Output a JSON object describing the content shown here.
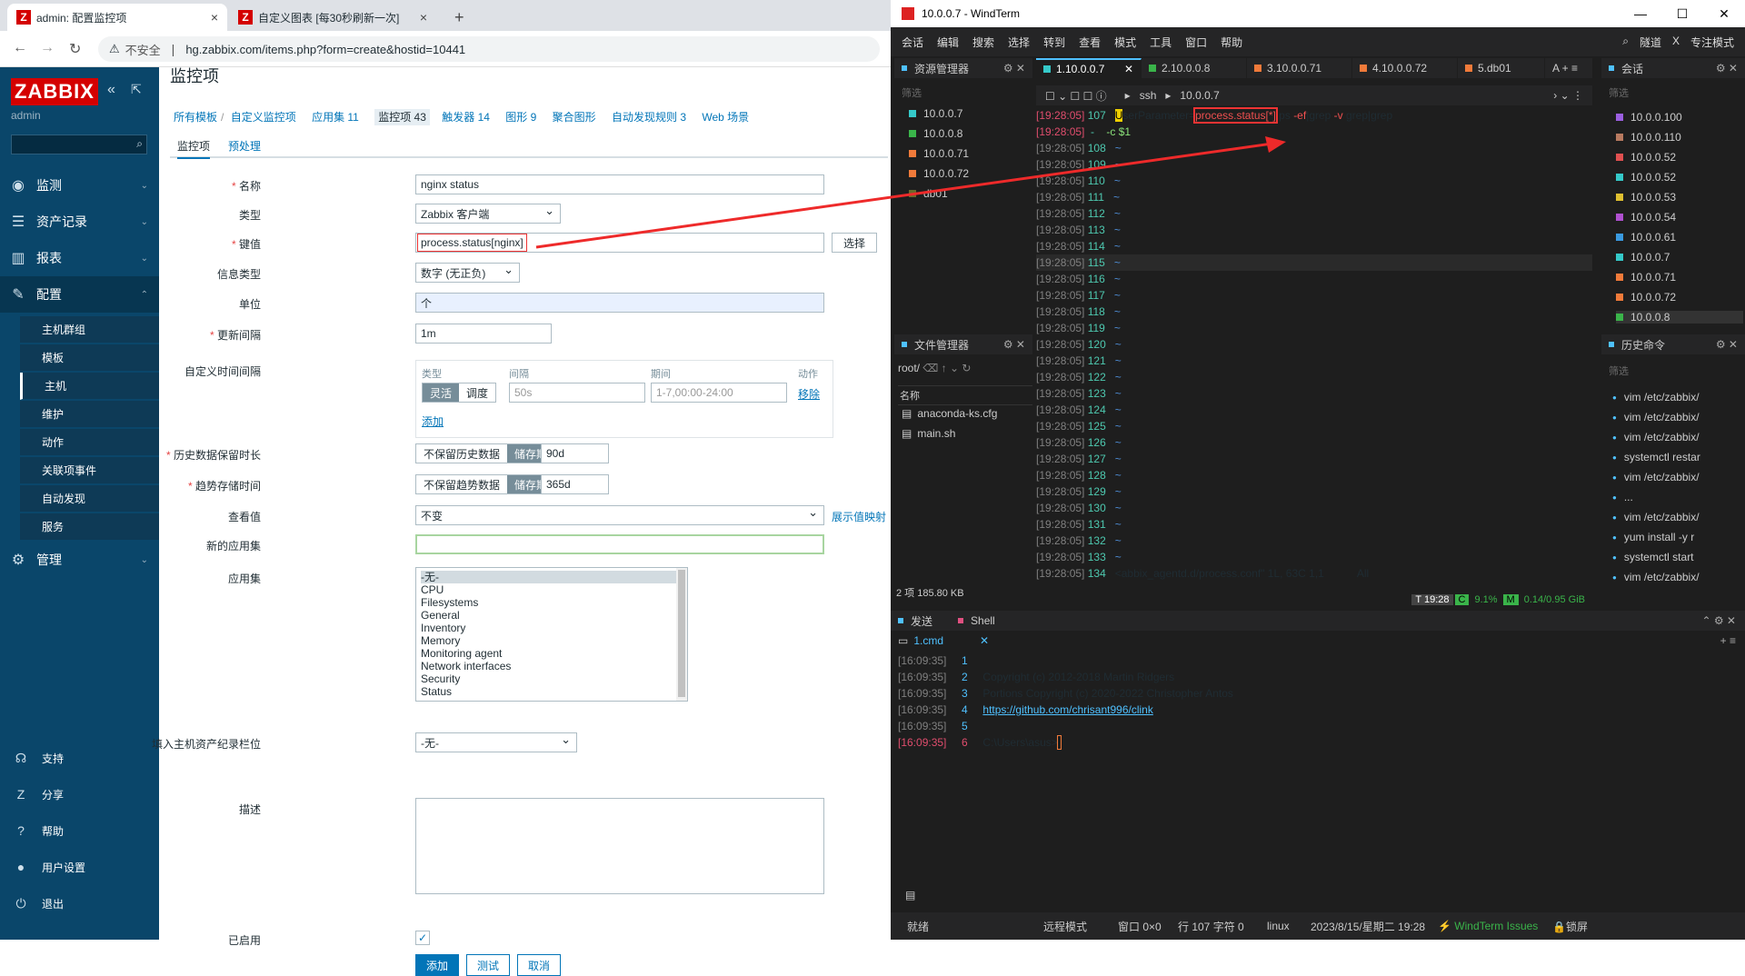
{
  "browser": {
    "tabs": [
      {
        "title": "admin: 配置监控项",
        "close": "×"
      },
      {
        "title": "自定义图表 [每30秒刷新一次]",
        "close": "×"
      }
    ],
    "new_tab": "+",
    "security": "不安全",
    "url": "hg.zabbix.com/items.php?form=create&hostid=10441"
  },
  "zabbix": {
    "logo": "ZABBIX",
    "user": "admin",
    "menu": [
      {
        "label": "监测",
        "icon": "eye-icon"
      },
      {
        "label": "资产记录",
        "icon": "list-icon"
      },
      {
        "label": "报表",
        "icon": "chart-icon"
      },
      {
        "label": "配置",
        "icon": "wrench-icon"
      },
      {
        "label": "管理",
        "icon": "gear-icon"
      }
    ],
    "config_sub": [
      "主机群组",
      "模板",
      "主机",
      "维护",
      "动作",
      "关联项事件",
      "自动发现",
      "服务"
    ],
    "bottom": [
      "支持",
      "分享",
      "帮助",
      "用户设置",
      "退出"
    ],
    "page_title": "监控项",
    "breadcrumb": [
      "所有模板",
      "自定义监控项",
      "应用集 11",
      "监控项 43",
      "触发器 14",
      "图形 9",
      "聚合图形",
      "自动发现规则 3",
      "Web 场景"
    ],
    "tabs": [
      "监控项",
      "预处理"
    ],
    "form": {
      "name_label": "名称",
      "name_value": "nginx status",
      "type_label": "类型",
      "type_value": "Zabbix 客户端",
      "key_label": "键值",
      "key_value": "process.status[nginx]",
      "select_btn": "选择",
      "info_label": "信息类型",
      "info_value": "数字 (无正负)",
      "unit_label": "单位",
      "unit_value": "个",
      "interval_label": "更新间隔",
      "interval_value": "1m",
      "custom_label": "自定义时间间隔",
      "ci_head_type": "类型",
      "ci_head_interval": "间隔",
      "ci_head_period": "期间",
      "ci_head_action": "动作",
      "ci_flexible": "灵活",
      "ci_scheduling": "调度",
      "ci_interval_ph": "50s",
      "ci_period_ph": "1-7,00:00-24:00",
      "ci_remove": "移除",
      "ci_add": "添加",
      "history_label": "历史数据保留时长",
      "history_off": "不保留历史数据",
      "history_on": "储存期",
      "history_value": "90d",
      "trend_label": "趋势存储时间",
      "trend_off": "不保留趋势数据",
      "trend_on": "储存期",
      "trend_value": "365d",
      "valuemap_label": "查看值",
      "valuemap_value": "不变",
      "valuemap_link": "展示值映射",
      "newapp_label": "新的应用集",
      "apps_label": "应用集",
      "apps": [
        "-无-",
        "CPU",
        "Filesystems",
        "General",
        "Inventory",
        "Memory",
        "Monitoring agent",
        "Network interfaces",
        "Security",
        "Status"
      ],
      "inventory_label": "填入主机资产纪录栏位",
      "inventory_value": "-无-",
      "desc_label": "描述",
      "enabled_label": "已启用",
      "btn_add": "添加",
      "btn_test": "测试",
      "btn_cancel": "取消"
    }
  },
  "windterm": {
    "title": "10.0.0.7 - WindTerm",
    "ctrl": [
      "—",
      "☐",
      "✕"
    ],
    "menu": [
      "会话",
      "编辑",
      "搜索",
      "选择",
      "转到",
      "查看",
      "模式",
      "工具",
      "窗口",
      "帮助"
    ],
    "menu_right": [
      "隧道",
      "X",
      "专注模式"
    ],
    "explorer": {
      "title": "资源管理器",
      "filter": "筛选",
      "items": [
        "10.0.0.7",
        "10.0.0.8",
        "10.0.0.71",
        "10.0.0.72",
        "db01"
      ]
    },
    "tabs": [
      "1.10.0.0.7",
      "2.10.0.0.8",
      "3.10.0.0.71",
      "4.10.0.0.72",
      "5.db01"
    ],
    "path": [
      "ssh",
      "10.0.0.7"
    ],
    "files": {
      "title": "文件管理器",
      "path": "root/",
      "col": "名称",
      "items": [
        "anaconda-ks.cfg",
        "main.sh"
      ],
      "status": "2 项 185.80 KB"
    },
    "sessions": {
      "title": "会话",
      "filter": "筛选",
      "items": [
        "10.0.0.100",
        "10.0.0.110",
        "10.0.0.52",
        "10.0.0.52",
        "10.0.0.53",
        "10.0.0.54",
        "10.0.0.61",
        "10.0.0.7",
        "10.0.0.71",
        "10.0.0.72",
        "10.0.0.8"
      ]
    },
    "history": {
      "title": "历史命令",
      "filter": "筛选",
      "items": [
        "vim /etc/zabbix/",
        "vim /etc/zabbix/",
        "vim /etc/zabbix/",
        "systemctl restar",
        "vim /etc/zabbix/",
        "...",
        "vim /etc/zabbix/",
        "yum install -y r",
        "systemctl start",
        "vim /etc/zabbix/"
      ]
    },
    "term": {
      "ts": "[19:28:05]",
      "line1_a": "U",
      "line1_b": "serParameter=",
      "line1_c": "process.status[*]",
      "line1_d": ",ps ",
      "line1_e": "-ef",
      "line1_f": "|grep ",
      "line1_g": "-v",
      "line1_h": " grep|grep ",
      "line2": "-c $1",
      "start": 107,
      "last": "<abbix_agentd.d/process.conf\" 1L, 63C 1,1           All"
    },
    "status": {
      "time": "19:28",
      "cpu": "9.1%",
      "mem": "0.14/0.95 GiB"
    },
    "bottom": {
      "send": "发送",
      "shell": "Shell",
      "tab": "1.cmd",
      "ts": "[16:09:35]",
      "lines": [
        "",
        "Copyright (c) 2012-2018 Martin Ridgers",
        "Portions Copyright (c) 2020-2022 Christopher Antos",
        "https://github.com/chrisant996/clink",
        "",
        "C:\\Users\\asus>"
      ]
    },
    "footer": {
      "ready": "就绪",
      "mode": "远程模式",
      "window": "窗口 0×0",
      "pos": "行 107 字符 0",
      "os": "linux",
      "date": "2023/8/15/星期二 19:28",
      "issues": "WindTerm Issues",
      "lock": "锁屏"
    }
  }
}
